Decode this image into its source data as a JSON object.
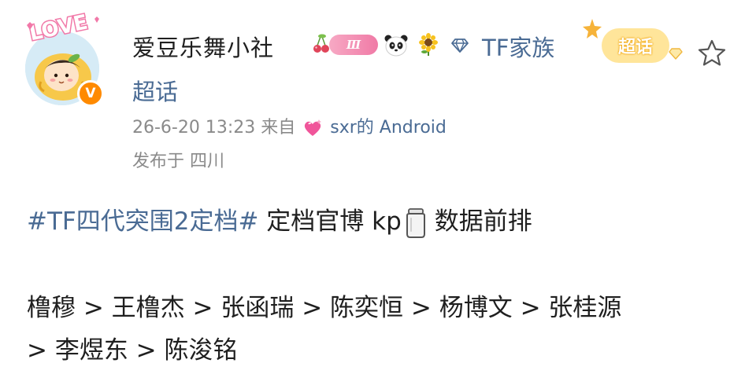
{
  "post": {
    "author": {
      "name": "爱豆乐舞小社",
      "avatar_badge": "LOVE",
      "verified_badge": "V",
      "level_badge": "Ⅲ",
      "family_label": "TF家族",
      "chaohua_badge": "超话",
      "chaohua_link": "超话"
    },
    "meta": {
      "timestamp": "26-6-20 13:23",
      "from_label": "来自",
      "source": "sxr的 Android",
      "location": "发布于 四川"
    },
    "content": {
      "hashtag": "#TF四代突围2定档#",
      "text_before_icon": " 定档官博 kp",
      "text_after_icon": "数据前排",
      "ranking_line1": "橹穆 > 王橹杰 > 张函瑞 > 陈奕恒 > 杨博文 > 张桂源",
      "ranking_line2": "> 李煜东 > 陈浚铭"
    },
    "icons": {
      "favorite": "star-outline-icon",
      "jar": "jar-emoji-icon",
      "heart": "sparkling-heart-icon",
      "panda": "panda-emoji-icon",
      "flower": "sunflower-emoji-icon",
      "diamond": "diamond-icon",
      "cherry": "cherry-icon"
    },
    "colors": {
      "link": "#4a6b94",
      "meta": "#8a8a8a",
      "text": "#1f1f1f",
      "verified": "#ff8a00",
      "level_pink": "#f07aa6",
      "chaohua_yellow": "#ffe59a"
    }
  }
}
